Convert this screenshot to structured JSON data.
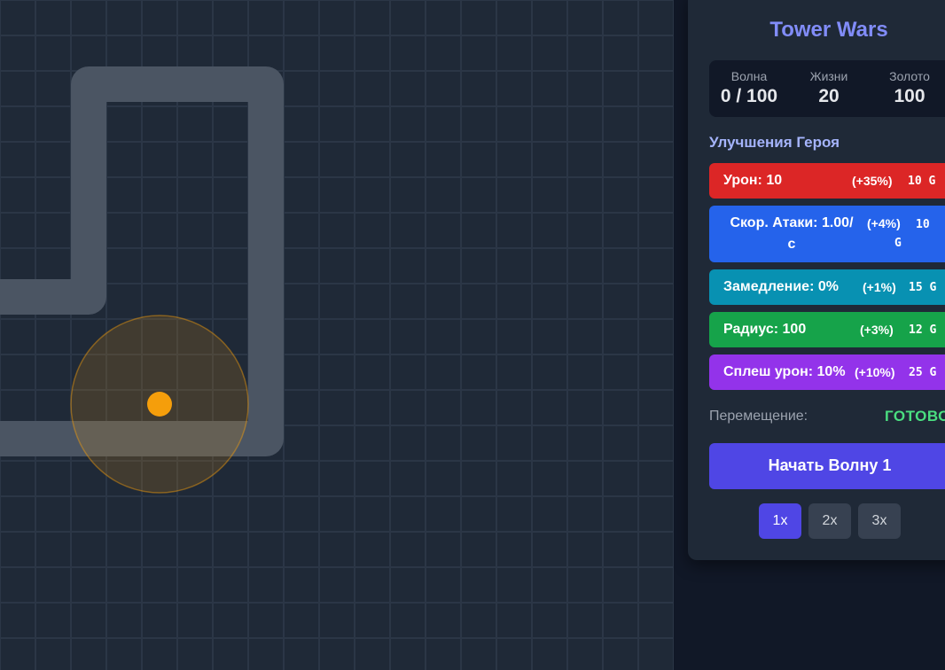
{
  "game": {
    "title": "Tower Wars",
    "path_color": "#4b5563",
    "hero_color": "#f59e0b",
    "grid_color": "#2b3646",
    "background_color": "#1f2937"
  },
  "stats": {
    "wave_label": "Волна",
    "wave_value": "0 / 100",
    "lives_label": "Жизни",
    "lives_value": "20",
    "gold_label": "Золото",
    "gold_value": "100"
  },
  "upgrades": {
    "title": "Улучшения Героя",
    "items": [
      {
        "line1": "Урон: 10",
        "line2": "",
        "pct": "(+35%)",
        "cost1": "10 G",
        "cost2": "",
        "color": "#dc2626"
      },
      {
        "line1": "Скор. Атаки: 1.00/",
        "line2": "с",
        "pct": "(+4%)",
        "cost1": "10",
        "cost2": "G",
        "color": "#2563eb"
      },
      {
        "line1": "Замедление: 0%",
        "line2": "",
        "pct": "(+1%)",
        "cost1": "15 G",
        "cost2": "",
        "color": "#0891b2"
      },
      {
        "line1": "Радиус: 100",
        "line2": "",
        "pct": "(+3%)",
        "cost1": "12 G",
        "cost2": "",
        "color": "#16a34a"
      },
      {
        "line1": "Сплеш урон: 10%",
        "line2": "",
        "pct": "(+10%)",
        "cost1": "25 G",
        "cost2": "",
        "color": "#9333ea"
      }
    ]
  },
  "movement": {
    "label": "Перемещение:",
    "status": "ГОТОВО"
  },
  "start_button": {
    "label": "Начать Волну 1"
  },
  "speed": {
    "options": [
      "1x",
      "2x",
      "3x"
    ],
    "selected": "1x"
  }
}
